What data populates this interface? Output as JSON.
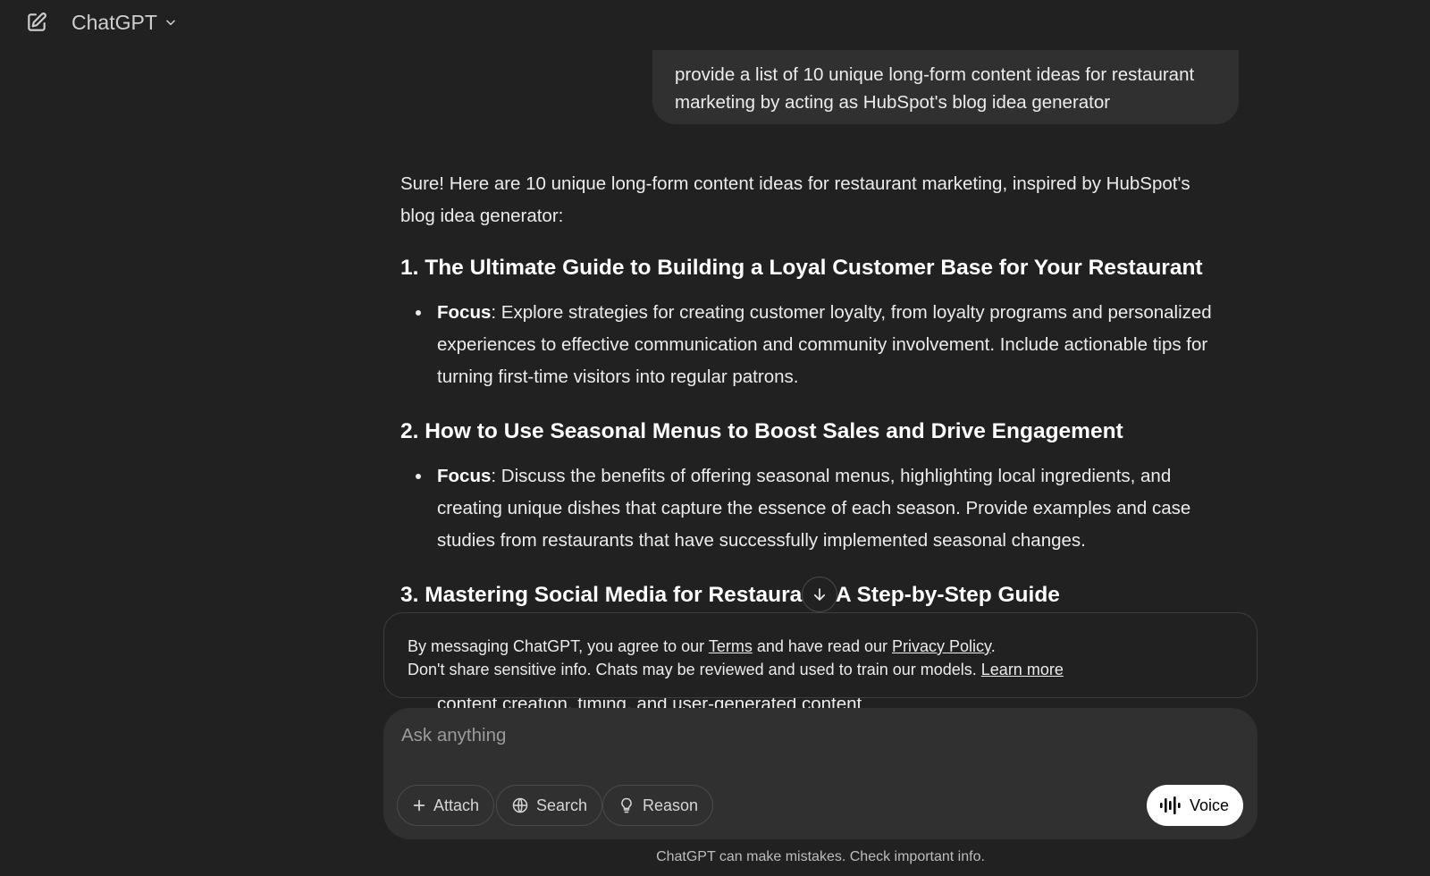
{
  "header": {
    "model_name": "ChatGPT",
    "new_chat_icon": "edit-icon",
    "dropdown_icon": "chevron-down-icon"
  },
  "user_message": {
    "line1": "provide a list of 10 unique long-form content ideas for restaurant",
    "line2": "marketing by acting as HubSpot's blog idea generator"
  },
  "assistant": {
    "intro_line1": "Sure! Here are 10 unique long-form content ideas for restaurant marketing, inspired by HubSpot's",
    "intro_line2": "blog idea generator:",
    "focus_label": "Focus",
    "items": [
      {
        "heading": "1. The Ultimate Guide to Building a Loyal Customer Base for Your Restaurant",
        "line1": ": Explore strategies for creating customer loyalty, from loyalty programs and personalized",
        "line2": "experiences to effective communication and community involvement. Include actionable tips for",
        "line3": "turning first-time visitors into regular patrons."
      },
      {
        "heading": "2. How to Use Seasonal Menus to Boost Sales and Drive Engagement",
        "line1": ": Discuss the benefits of offering seasonal menus, highlighting local ingredients, and",
        "line2": "creating unique dishes that capture the essence of each season. Provide examples and case",
        "line3": "studies from restaurants that have successfully implemented seasonal changes."
      },
      {
        "heading_a": "3. Mastering Social Media for Restaura",
        "heading_b": "s: A Step-by-Step Guide",
        "peek": "content creation, timing, and user-generated content"
      }
    ]
  },
  "disclaimer": {
    "part1": "By messaging ChatGPT, you agree to our ",
    "terms": "Terms",
    "part2": " and have read our ",
    "privacy": "Privacy Policy",
    "part3": ".",
    "line2": "Don't share sensitive info. Chats may be reviewed and used to train our models. ",
    "learn_more": "Learn more"
  },
  "composer": {
    "placeholder": "Ask anything",
    "attach": "Attach",
    "search": "Search",
    "reason": "Reason",
    "voice": "Voice"
  },
  "footer": "ChatGPT can make mistakes. Check important info."
}
